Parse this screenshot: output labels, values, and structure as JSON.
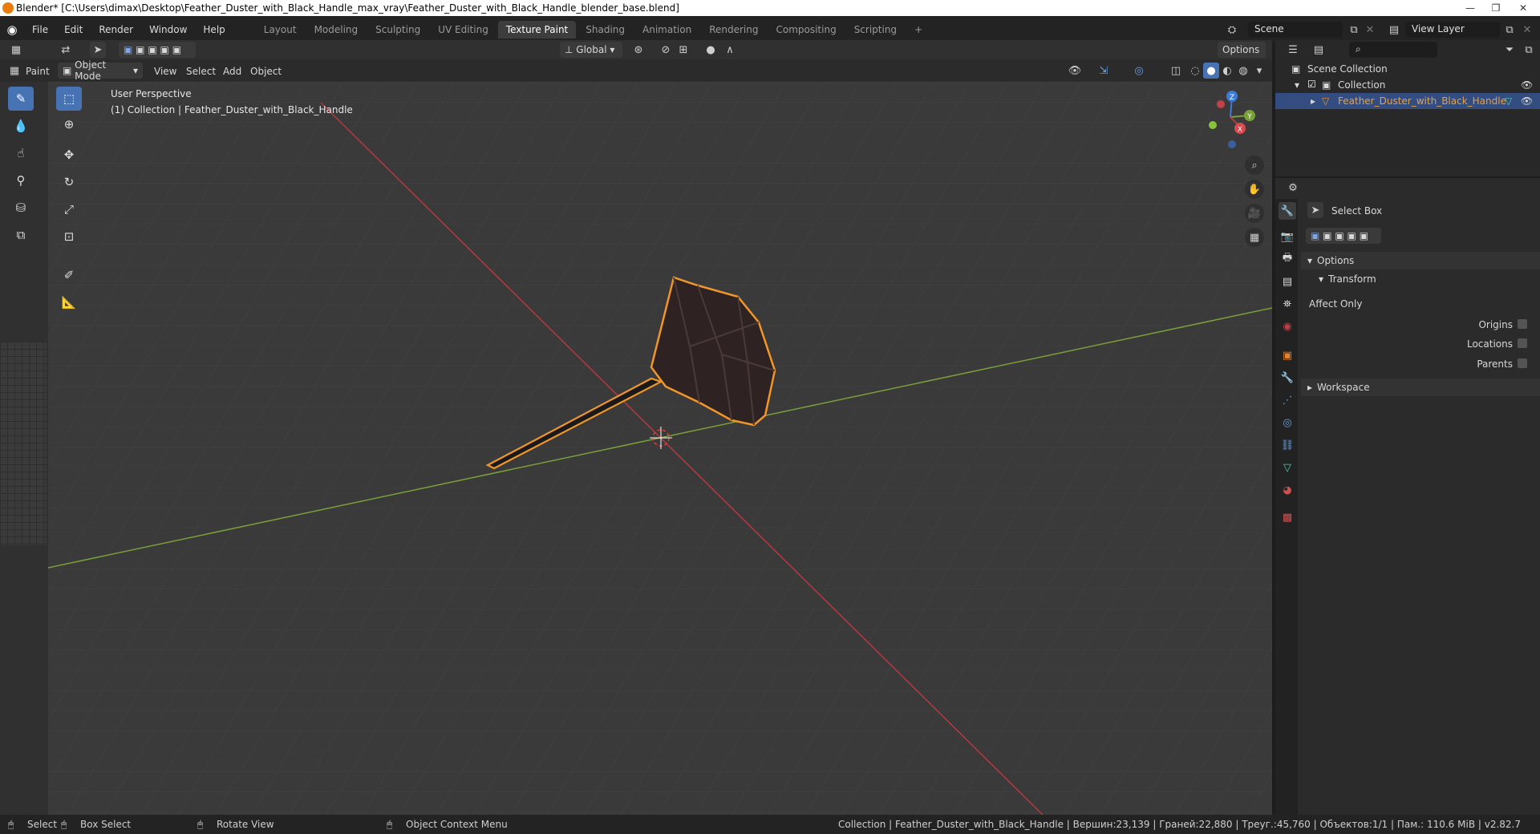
{
  "window": {
    "title": "Blender* [C:\\Users\\dimax\\Desktop\\Feather_Duster_with_Black_Handle_max_vray\\Feather_Duster_with_Black_Handle_blender_base.blend]",
    "minimize": "—",
    "maximize": "❐",
    "close": "✕"
  },
  "menu": {
    "items": [
      "File",
      "Edit",
      "Render",
      "Window",
      "Help"
    ]
  },
  "workspaces": {
    "tabs": [
      "Layout",
      "Modeling",
      "Sculpting",
      "UV Editing",
      "Texture Paint",
      "Shading",
      "Animation",
      "Rendering",
      "Compositing",
      "Scripting"
    ],
    "active": "Texture Paint",
    "add": "+"
  },
  "scene": {
    "label": "Scene",
    "view_layer": "View Layer"
  },
  "viewport_header": {
    "orientation": "Global",
    "options": "Options",
    "mode_label": "Paint",
    "object_mode": "Object Mode",
    "menus": [
      "View",
      "Select",
      "Add",
      "Object"
    ]
  },
  "viewport": {
    "perspective": "User Perspective",
    "collection_info": "(1) Collection | Feather_Duster_with_Black_Handle",
    "gizmo": {
      "x": "X",
      "y": "Y",
      "z": "Z"
    }
  },
  "outliner": {
    "scene_collection": "Scene Collection",
    "collection": "Collection",
    "object": "Feather_Duster_with_Black_Handle"
  },
  "properties": {
    "tool_name": "Select Box",
    "options": "Options",
    "transform": "Transform",
    "affect_only": "Affect Only",
    "origins": "Origins",
    "locations": "Locations",
    "parents": "Parents",
    "workspace": "Workspace"
  },
  "status": {
    "select": "Select",
    "box_select": "Box Select",
    "rotate_view": "Rotate View",
    "context_menu": "Object Context Menu",
    "stats": "Collection | Feather_Duster_with_Black_Handle | Вершин:23,139 | Граней:22,880 | Треуг.:45,760 | Объектов:1/1 | Пам.: 110.6 MiB | v2.82.7"
  },
  "colors": {
    "accent": "#4772b3",
    "selection_outline": "#f0962a",
    "x_axis": "#b5393f",
    "y_axis": "#7aa03a",
    "z_axis": "#3d7cd6"
  }
}
